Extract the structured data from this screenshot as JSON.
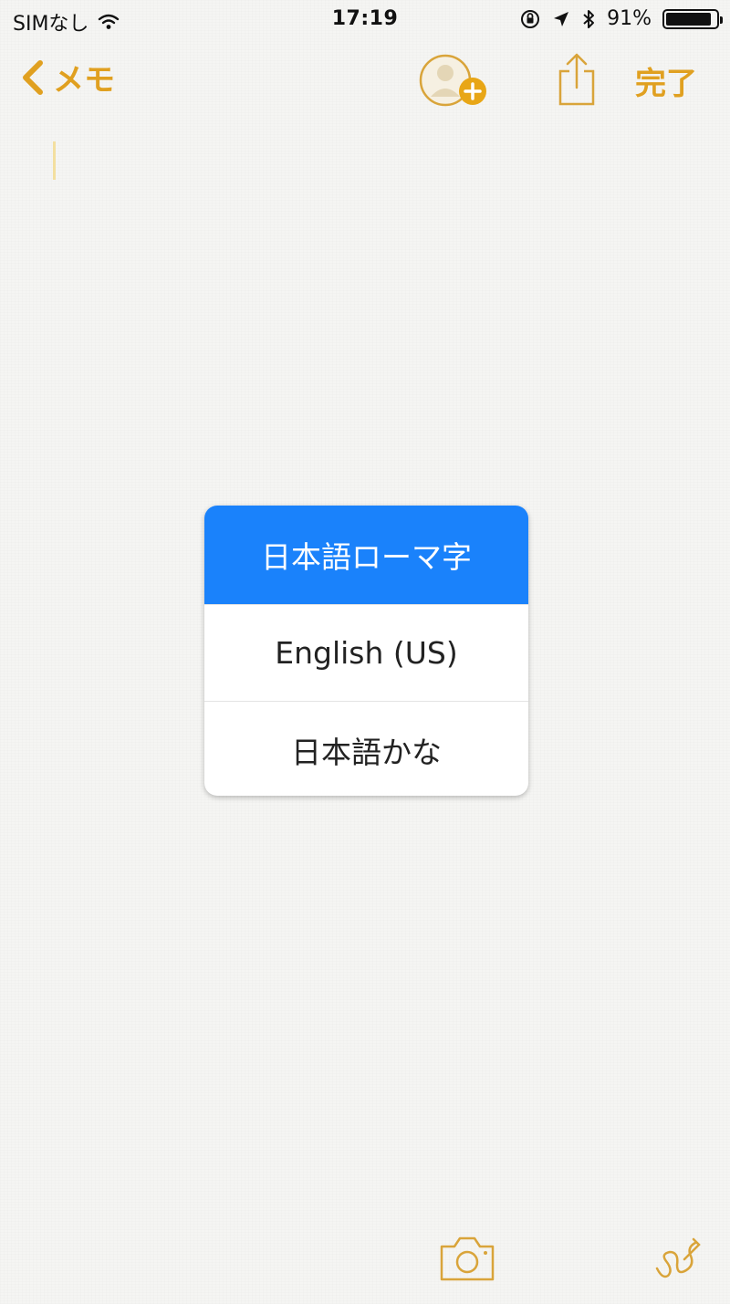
{
  "status_bar": {
    "carrier": "SIMなし",
    "time": "17:19",
    "battery_text": "91%",
    "battery_level": 0.91
  },
  "nav": {
    "back_label": "メモ",
    "done_label": "完了"
  },
  "language_popup": {
    "options": [
      {
        "label": "日本語ローマ字",
        "selected": true
      },
      {
        "label": "English (US)",
        "selected": false
      },
      {
        "label": "日本語かな",
        "selected": false
      }
    ]
  },
  "colors": {
    "accent": "#e0a020",
    "selected": "#1a82fb",
    "background": "#f5f5f3"
  },
  "icons": {
    "wifi": "wifi-icon",
    "location": "location-arrow-icon",
    "bluetooth": "bluetooth-icon",
    "lock_rotation": "orientation-lock-icon",
    "back": "chevron-left-icon",
    "add_person": "add-person-icon",
    "share": "share-icon",
    "camera": "camera-icon",
    "sketch": "sketch-pen-icon"
  }
}
